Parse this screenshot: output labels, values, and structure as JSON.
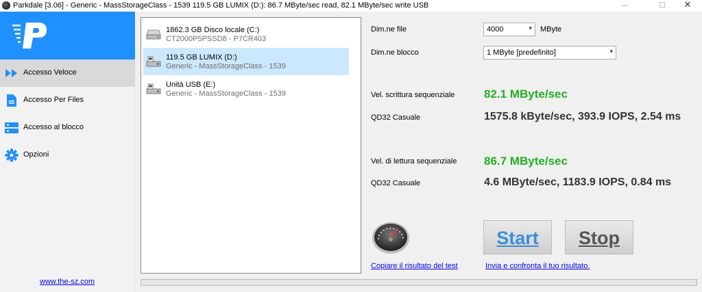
{
  "window": {
    "title": "Parkdale [3.06] - Generic - MassStorageClass - 1539 119.5 GB LUMIX (D:): 86.7 MByte/sec read, 82.1 MByte/sec write USB",
    "min_glyph": "—",
    "max_glyph": "☐",
    "close_glyph": "✕"
  },
  "colors": {
    "logo_bg": "#1e90ff",
    "accent_blue": "#1e90ff",
    "result_green": "#22b022",
    "selected_row": "#cce8ff",
    "link": "#0000ee"
  },
  "sidebar": {
    "logo_letter": "P",
    "items": [
      {
        "label": "Accesso Veloce",
        "icon": "fast-forward-icon",
        "active": true
      },
      {
        "label": "Accesso Per Files",
        "icon": "document-icon",
        "active": false
      },
      {
        "label": "Accesso al blocco",
        "icon": "server-blocks-icon",
        "active": false
      },
      {
        "label": "Opzioni",
        "icon": "gear-icon",
        "active": false
      }
    ],
    "site_link": "www.the-sz.com"
  },
  "drives": [
    {
      "name": "1862.3 GB Disco locale (C:)",
      "sub": "CT2000P5PSSD8 - P7CR403",
      "icon": "hard-drive-icon",
      "selected": false
    },
    {
      "name": "119.5 GB LUMIX (D:)",
      "sub": "Generic - MassStorageClass - 1539",
      "icon": "removable-drive-icon",
      "selected": true
    },
    {
      "name": "Unità USB (E:)",
      "sub": "Generic - MassStorageClass - 1539",
      "icon": "removable-drive-icon",
      "selected": false
    }
  ],
  "settings": {
    "file_size_label": "Dim.ne file",
    "file_size_value": "4000",
    "file_size_unit": "MByte",
    "block_size_label": "Dim.ne blocco",
    "block_size_value": "1 MByte [predefinito]"
  },
  "results": {
    "write_label": "Vel. scrittura sequenziale",
    "write_value": "82.1 MByte/sec",
    "write_qd32_label": "QD32 Casuale",
    "write_qd32_value": "1575.8 kByte/sec, 393.9 IOPS, 2.54 ms",
    "read_label": "Vel. di lettura sequenziale",
    "read_value": "86.7 MByte/sec",
    "read_qd32_label": "QD32 Casuale",
    "read_qd32_value": "4.6 MByte/sec, 1183.9 IOPS, 0.84 ms"
  },
  "actions": {
    "start_label": "Start",
    "stop_label": "Stop",
    "copy_link": "Copiare il risultato del test",
    "compare_link": "Invia e confronta il tuo risultato.",
    "speedometer_icon": "speedometer-icon"
  },
  "progress": {
    "fraction": 0
  }
}
